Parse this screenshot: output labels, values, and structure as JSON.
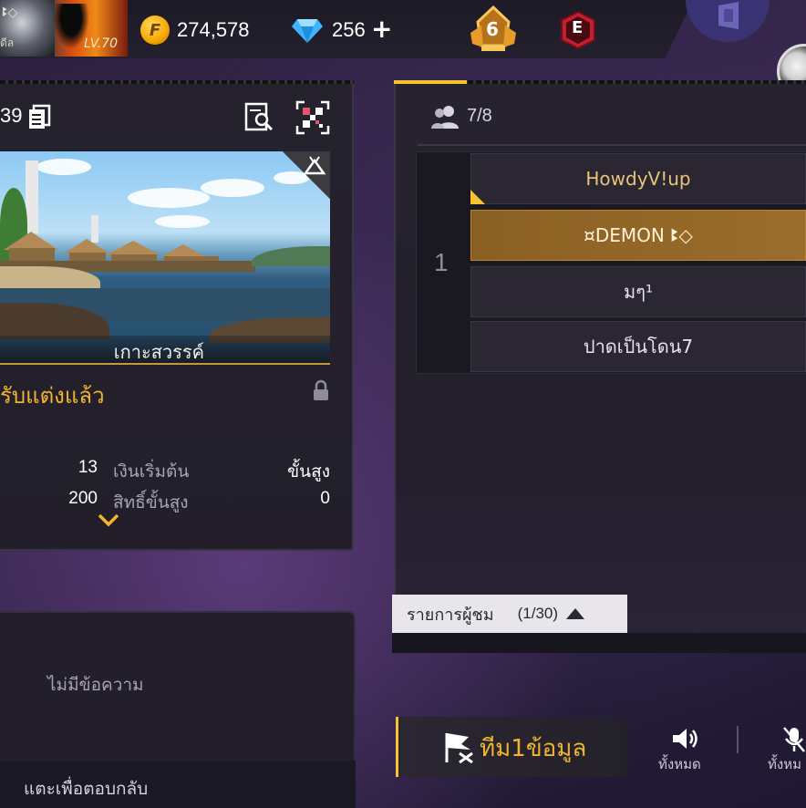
{
  "player": {
    "name": "ꔪ◇",
    "tag": "ดีล",
    "level": "LV.70"
  },
  "currency": {
    "gold": "274,578",
    "diamonds": "256",
    "diamonds_add": "+"
  },
  "rank": {
    "tier_number": "6",
    "elite_letter": "E"
  },
  "room": {
    "id_partial": "39",
    "map_name": "เกาะสวรรค์",
    "status": "รับแต่งแล้ว",
    "settings": [
      {
        "value": "13",
        "label": "เงินเริ่มต้น",
        "right": "ขั้นสูง"
      },
      {
        "value": "200",
        "label": "สิทธิ์ขั้นสูง",
        "right": "0"
      }
    ]
  },
  "chat": {
    "empty_message": "ไม่มีข้อความ",
    "reply_hint": "แตะเพื่อตอบกลับ"
  },
  "team": {
    "players_count": "7/8",
    "team_number": "1",
    "slots": [
      "HowdyV!up",
      "¤DEMON ꔪ◇",
      "มๆ¹",
      "ปาดเป็นโดน7"
    ],
    "spectator_label": "รายการผู้ชม",
    "spectator_count": "(1/30)"
  },
  "actions": {
    "team_info_prefix": "ทีม1",
    "team_info_suffix": "ข้อมูล",
    "speaker_label": "ทั้งหมด",
    "mic_label": "ทั้งหม"
  },
  "colors": {
    "accent_gold": "#f1b52d",
    "selected_slot": "#9b6d2c",
    "panel": "#25222e"
  },
  "icons": [
    "copy-icon",
    "search-room-icon",
    "qr-icon",
    "lock-icon",
    "players-icon",
    "flag-icon",
    "speaker-icon",
    "mic-off-icon",
    "diamond-icon",
    "gold-coin-icon"
  ]
}
